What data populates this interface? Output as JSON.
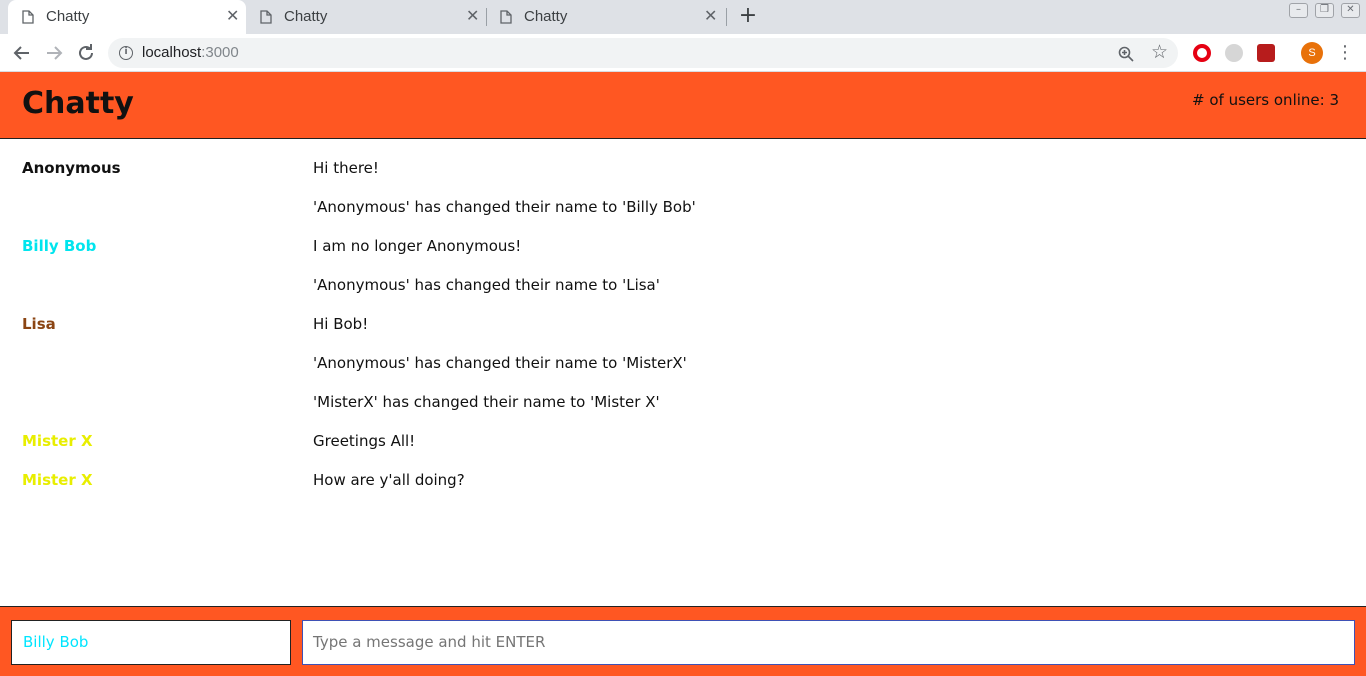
{
  "browser": {
    "tabs": [
      {
        "title": "Chatty",
        "active": true
      },
      {
        "title": "Chatty",
        "active": false
      },
      {
        "title": "Chatty",
        "active": false
      }
    ],
    "new_tab_label": "+",
    "url_host": "localhost",
    "url_port": ":3000",
    "profile_initial": "S",
    "window_controls": [
      "–",
      "❐",
      "✕"
    ]
  },
  "app": {
    "brand": "Chatty",
    "users_online": "# of users online: 3",
    "accent_color": "#ff5722"
  },
  "messages": [
    {
      "username": "Anonymous",
      "content": "Hi there!",
      "color": "#111111"
    },
    {
      "username": "",
      "content": "'Anonymous' has changed their name to 'Billy Bob'",
      "color": ""
    },
    {
      "username": "Billy Bob",
      "content": "I am no longer Anonymous!",
      "color": "#00e5ee"
    },
    {
      "username": "",
      "content": "'Anonymous' has changed their name to 'Lisa'",
      "color": ""
    },
    {
      "username": "Lisa",
      "content": "Hi Bob!",
      "color": "#8b4513"
    },
    {
      "username": "",
      "content": "'Anonymous' has changed their name to 'MisterX'",
      "color": ""
    },
    {
      "username": "",
      "content": "'MisterX' has changed their name to 'Mister X'",
      "color": ""
    },
    {
      "username": "Mister X",
      "content": "Greetings All!",
      "color": "#e8ee00"
    },
    {
      "username": "Mister X",
      "content": "How are y'all doing?",
      "color": "#e8ee00"
    }
  ],
  "chatbar": {
    "username_value": "Billy Bob",
    "message_placeholder": "Type a message and hit ENTER"
  }
}
